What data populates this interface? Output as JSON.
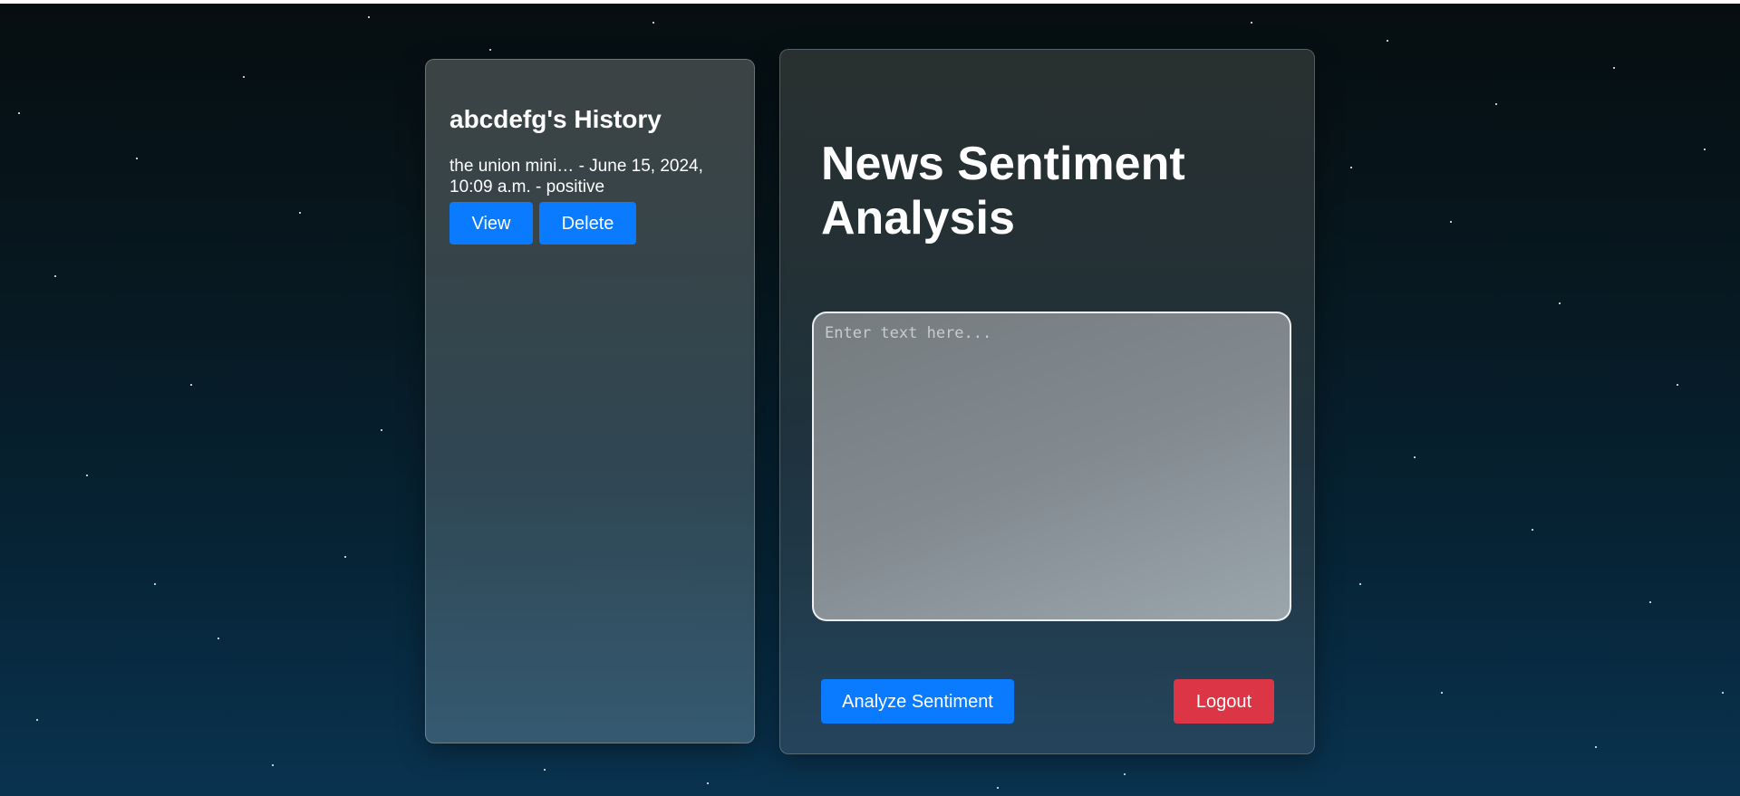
{
  "history": {
    "title": "abcdefg's History",
    "entries": [
      {
        "text": "the union mini… - June 15, 2024, 10:09 a.m. - positive",
        "view_label": "View",
        "delete_label": "Delete"
      }
    ]
  },
  "main": {
    "title": "News Sentiment Analysis",
    "input": {
      "placeholder": "Enter text here...",
      "value": ""
    },
    "analyze_label": "Analyze Sentiment",
    "logout_label": "Logout"
  },
  "colors": {
    "primary_button": "#0a7bff",
    "danger_button": "#dc3545"
  }
}
